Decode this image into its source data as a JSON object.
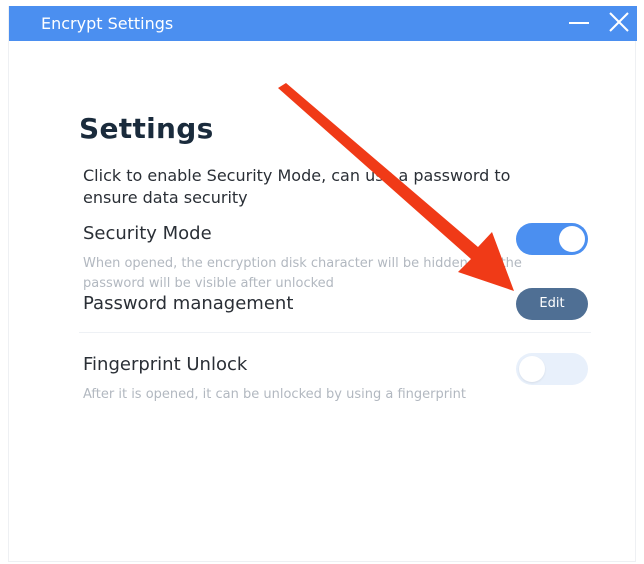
{
  "window": {
    "title": "Encrypt Settings",
    "accent": "#4b8ff0"
  },
  "main": {
    "heading": "Settings",
    "intro": "Click to enable  Security Mode, can use a password to ensure data security",
    "security_mode": {
      "label": "Security Mode",
      "description": "When opened, the encryption disk character will be hidden and the password will be visible after unlocked",
      "enabled": true
    },
    "password_management": {
      "label": "Password management",
      "button_label": "Edit"
    },
    "fingerprint_unlock": {
      "label": "Fingerprint Unlock",
      "description": "After it is opened, it can be unlocked by using a fingerprint",
      "enabled": false
    }
  },
  "annotation": {
    "arrow_color": "#f03a17"
  }
}
